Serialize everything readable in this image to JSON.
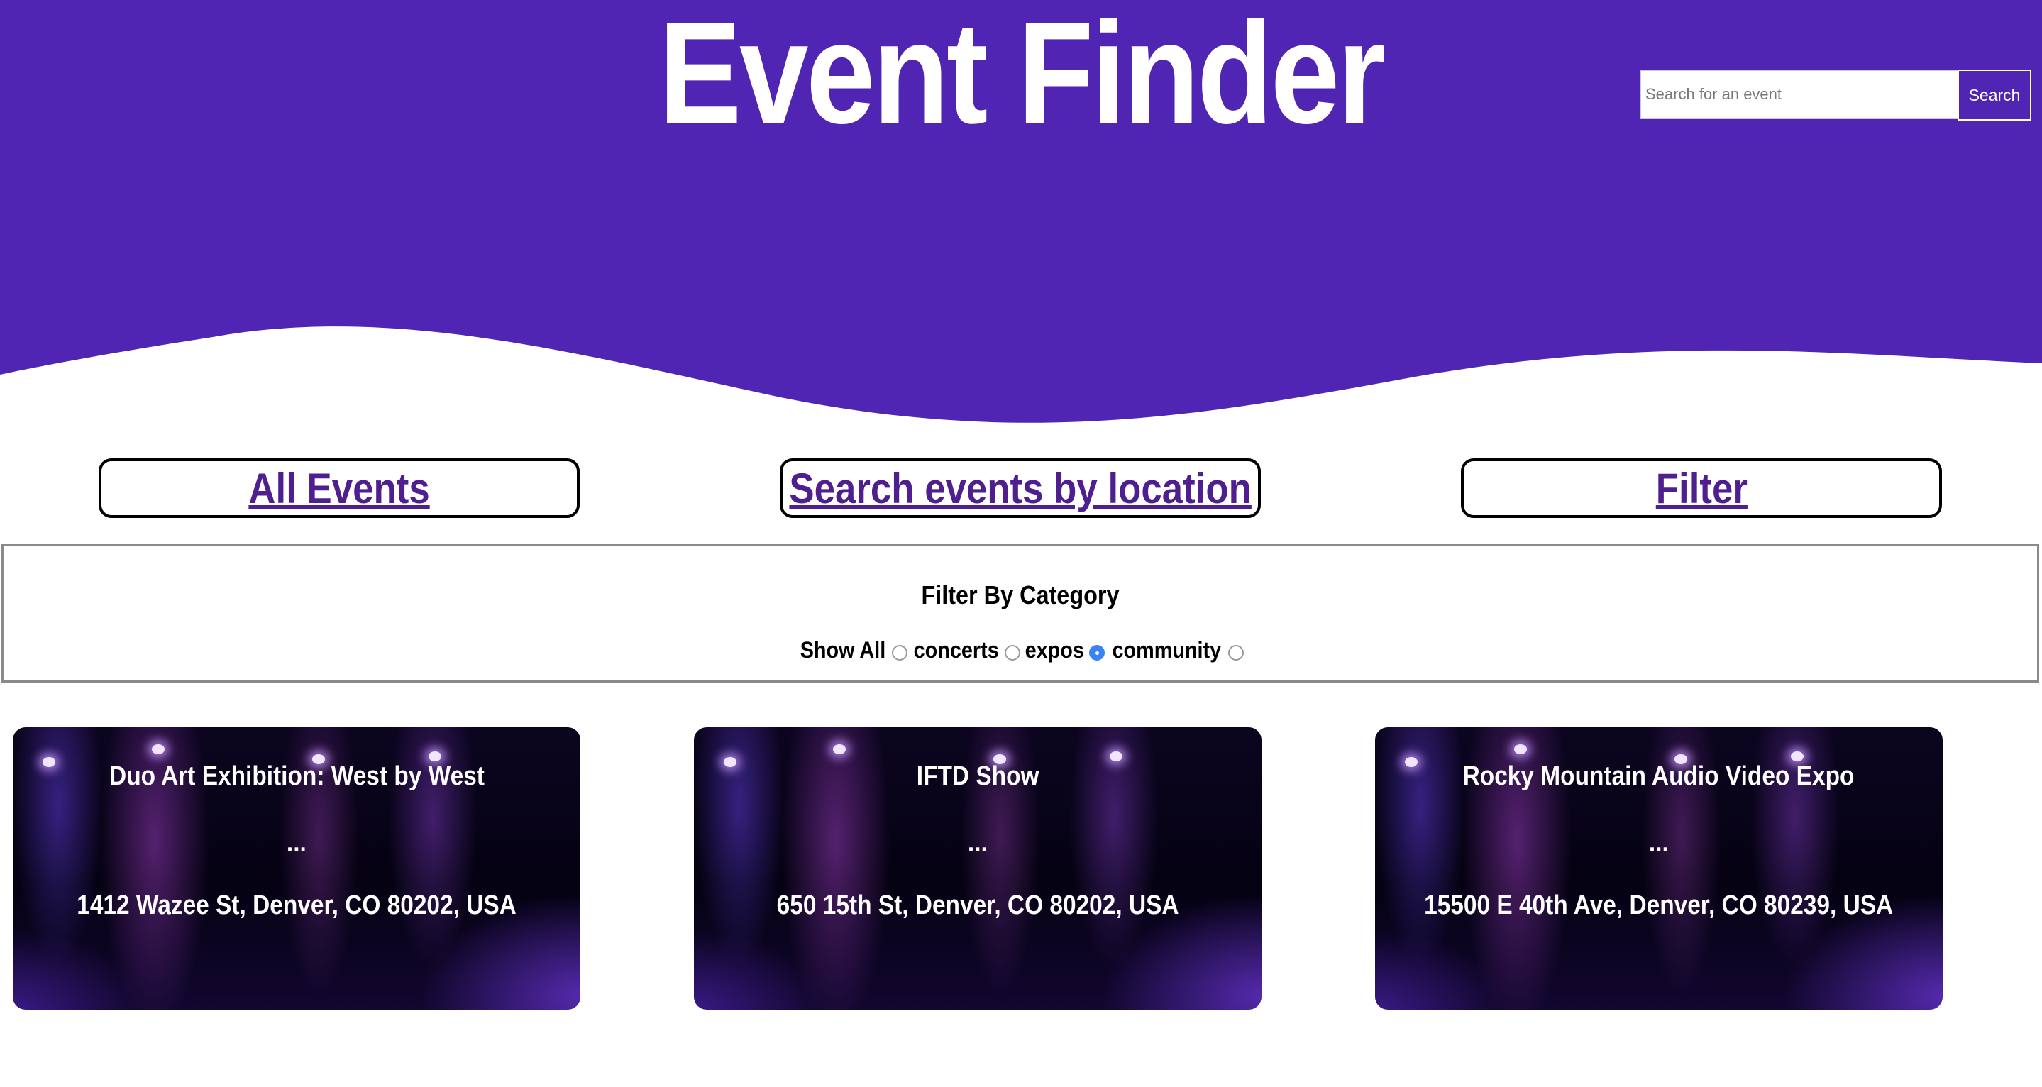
{
  "header": {
    "title": "Event Finder",
    "background_color": "#5125b3",
    "search": {
      "placeholder": "Search for an event",
      "value": "",
      "button_label": "Search"
    }
  },
  "nav": {
    "all_events": "All Events",
    "search_by_location": "Search events by location",
    "filter": "Filter",
    "link_color": "#4f1f8f"
  },
  "filter_panel": {
    "title": "Filter By Category",
    "options": [
      {
        "label": "Show All",
        "selected": false
      },
      {
        "label": "concerts",
        "selected": false
      },
      {
        "label": "expos",
        "selected": true
      },
      {
        "label": "community",
        "selected": false
      }
    ]
  },
  "events": [
    {
      "title": "Duo Art Exhibition: West by West",
      "dots": "...",
      "address": "1412 Wazee St, Denver, CO 80202, USA"
    },
    {
      "title": "IFTD Show",
      "dots": "...",
      "address": "650 15th St, Denver, CO 80202, USA"
    },
    {
      "title": "Rocky Mountain Audio Video Expo",
      "dots": "...",
      "address": "15500 E 40th Ave, Denver, CO 80239, USA"
    }
  ]
}
